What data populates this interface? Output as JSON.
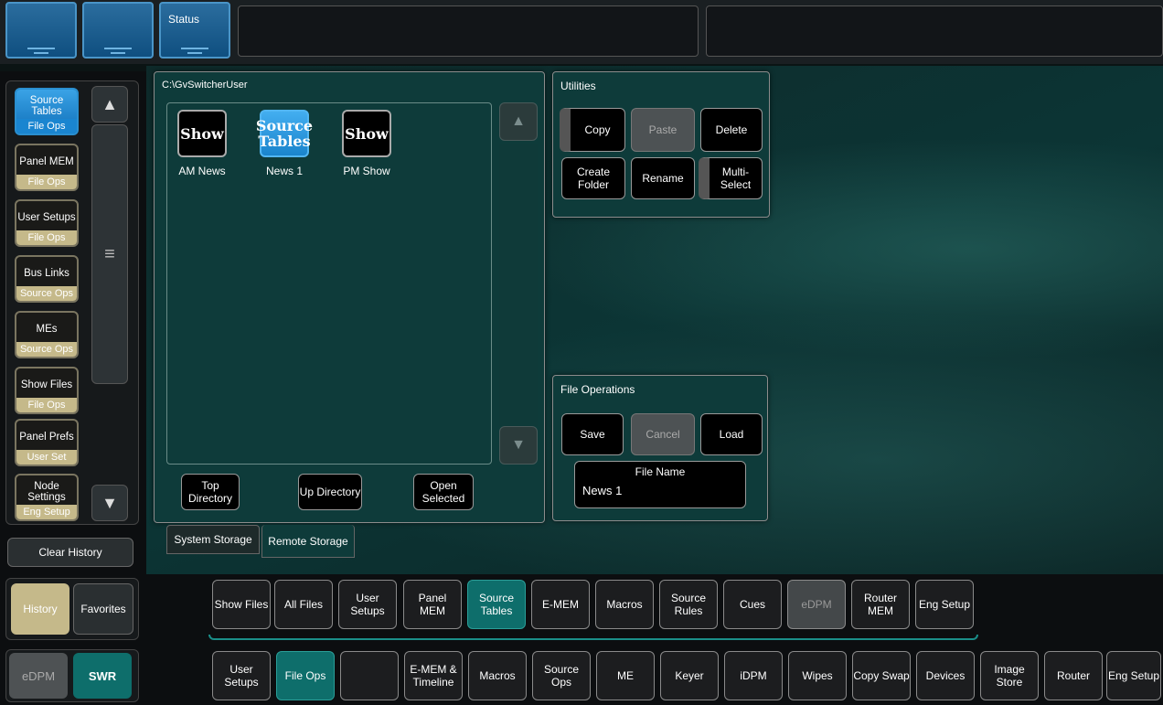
{
  "topbar": {
    "status_label": "Status"
  },
  "history": {
    "items": [
      {
        "title": "Source Tables",
        "sub": "File Ops",
        "selected": true
      },
      {
        "title": "Panel MEM",
        "sub": "File Ops"
      },
      {
        "title": "User Setups",
        "sub": "File Ops"
      },
      {
        "title": "Bus Links",
        "sub": "Source Ops"
      },
      {
        "title": "MEs",
        "sub": "Source Ops"
      },
      {
        "title": "Show Files",
        "sub": "File Ops"
      },
      {
        "title": "Panel Prefs",
        "sub": "User Set"
      },
      {
        "title": "Node Settings",
        "sub": "Eng Setup"
      }
    ],
    "clear_label": "Clear History",
    "history_tab": "History",
    "favorites_tab": "Favorites",
    "edpm_label": "eDPM",
    "swr_label": "SWR"
  },
  "browser": {
    "path": "C:\\GvSwitcherUser",
    "files": [
      {
        "icon_text": "Show",
        "label": "AM News"
      },
      {
        "icon_text": "Source Tables",
        "label": "News 1",
        "selected": true
      },
      {
        "icon_text": "Show",
        "label": "PM Show"
      }
    ],
    "top_directory": "Top Directory",
    "up_directory": "Up Directory",
    "open_selected": "Open Selected",
    "tab_system": "System Storage",
    "tab_remote": "Remote Storage"
  },
  "utilities": {
    "title": "Utilities",
    "copy": "Copy",
    "paste": "Paste",
    "delete": "Delete",
    "create_folder": "Create Folder",
    "rename": "Rename",
    "multi_select": "Multi-Select"
  },
  "file_operations": {
    "title": "File Operations",
    "save": "Save",
    "cancel": "Cancel",
    "load": "Load",
    "file_name_label": "File Name",
    "file_name_value": "News 1"
  },
  "nav_row1": [
    "Show Files",
    "All Files",
    "User Setups",
    "Panel MEM",
    "Source Tables",
    "E-MEM",
    "Macros",
    "Source Rules",
    "Cues",
    "eDPM",
    "Router MEM",
    "Eng Setup"
  ],
  "nav_row2": [
    "User Setups",
    "File Ops",
    "",
    "E-MEM & Timeline",
    "Macros",
    "Source Ops",
    "ME",
    "Keyer",
    "iDPM",
    "Wipes",
    "Copy Swap",
    "Devices",
    "Image Store",
    "Router",
    "Eng Setup"
  ]
}
